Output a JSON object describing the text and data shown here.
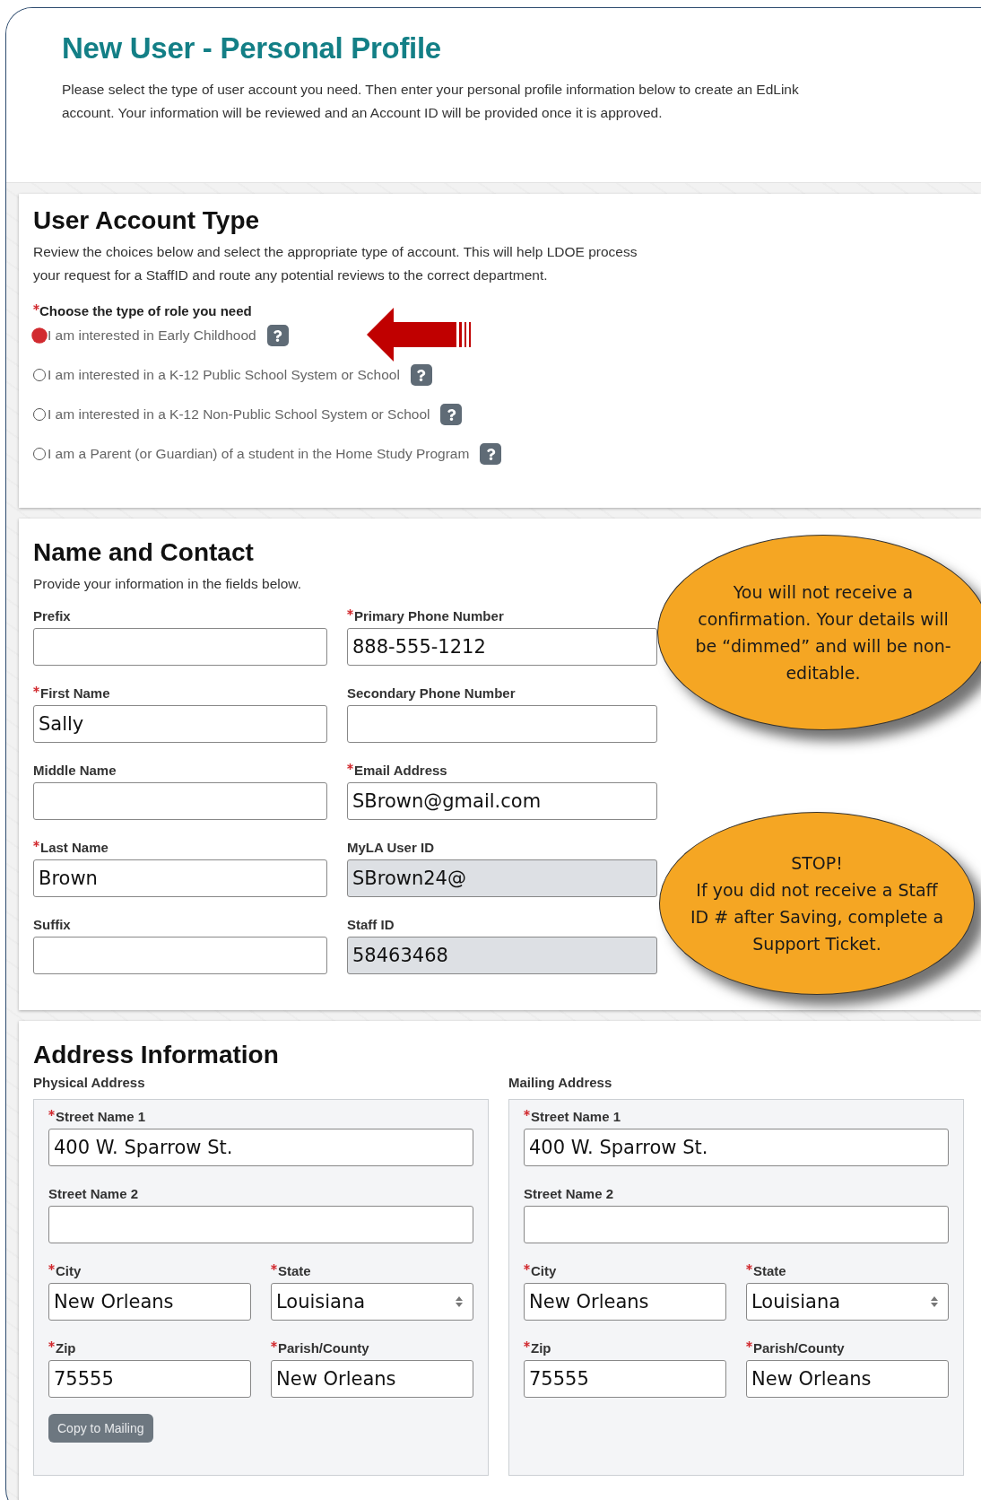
{
  "header": {
    "title": "New User - Personal Profile",
    "description": "Please select the type of user account you need. Then enter your personal profile information below to create an EdLink account. Your information will be reviewed and an Account ID will be provided once it is approved."
  },
  "account_type": {
    "title": "User Account Type",
    "description": "Review the choices below and select the appropriate type of account. This will help LDOE process your request for a StaffID and route any potential reviews to the correct department.",
    "question": {
      "label": "Choose the type of role you need",
      "required": true
    },
    "options": [
      {
        "label": "I am interested in Early Childhood",
        "selected": true,
        "pointed": true
      },
      {
        "label": "I am interested in a K-12 Public School System or School",
        "selected": false,
        "pointed": false
      },
      {
        "label": "I am interested in a K-12 Non-Public School System or School",
        "selected": false,
        "pointed": false
      },
      {
        "label": "I am a Parent (or Guardian) of a student in the Home Study Program",
        "selected": false,
        "pointed": false
      }
    ]
  },
  "name_contact": {
    "title": "Name and Contact",
    "description": "Provide your information in the fields below.",
    "fields": [
      {
        "label": "Prefix",
        "required": false,
        "disabled": false
      },
      {
        "label": "Primary Phone Number",
        "required": true,
        "value": "888-555-1212",
        "disabled": false
      },
      {
        "label": "First Name",
        "required": true,
        "value": "Sally",
        "disabled": false
      },
      {
        "label": "Secondary Phone Number",
        "required": false,
        "disabled": false
      },
      {
        "label": "Middle Name",
        "required": false,
        "disabled": false
      },
      {
        "label": "Email Address",
        "required": true,
        "value": "SBrown@gmail.com",
        "disabled": false
      },
      {
        "label": "Last Name",
        "required": true,
        "value": "Brown",
        "disabled": false
      },
      {
        "label": "MyLA User ID",
        "required": false,
        "value": "SBrown24@",
        "disabled": true
      },
      {
        "label": "Suffix",
        "required": false,
        "disabled": false
      },
      {
        "label": "Staff ID",
        "required": false,
        "value": "58463468",
        "disabled": true
      }
    ]
  },
  "callouts": [
    {
      "text": "You will not receive a confirmation. Your details will be “dimmed” and will be non-editable."
    },
    {
      "text": "STOP!\nIf you did not receive a Staff ID # after Saving, complete a Support Ticket."
    }
  ],
  "address": {
    "title": "Address Information",
    "groups": [
      {
        "title": "Physical Address",
        "fields": [
          {
            "label": "Street Name 1",
            "required": true,
            "value": "400 W. Sparrow St.",
            "kind": "wide"
          },
          {
            "label": "Street Name 2",
            "required": false,
            "kind": "wide"
          },
          {
            "label": "City",
            "required": true,
            "value": "New Orleans",
            "kind": "text"
          },
          {
            "label": "State",
            "required": true,
            "value": "Louisiana",
            "kind": "select"
          },
          {
            "label": "Zip",
            "required": true,
            "value": "75555",
            "kind": "text"
          },
          {
            "label": "Parish/County",
            "required": true,
            "value": "New Orleans",
            "kind": "text"
          }
        ],
        "button": "Copy to Mailing"
      },
      {
        "title": "Mailing Address",
        "fields": [
          {
            "label": "Street Name 1",
            "required": true,
            "value": "400 W. Sparrow St.",
            "kind": "wide"
          },
          {
            "label": "Street Name 2",
            "required": false,
            "kind": "wide"
          },
          {
            "label": "City",
            "required": true,
            "value": "New Orleans",
            "kind": "text"
          },
          {
            "label": "State",
            "required": true,
            "value": "Louisiana",
            "kind": "select"
          },
          {
            "label": "Zip",
            "required": true,
            "value": "75555",
            "kind": "text"
          },
          {
            "label": "Parish/County",
            "required": true,
            "value": "New Orleans",
            "kind": "text"
          }
        ]
      }
    ]
  }
}
